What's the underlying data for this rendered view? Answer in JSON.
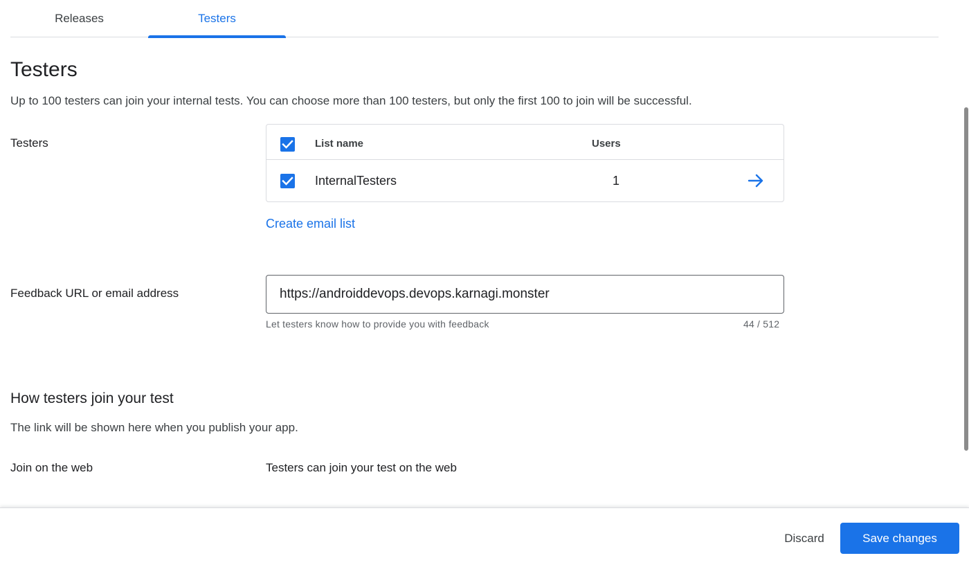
{
  "tabs": [
    {
      "label": "Releases",
      "active": false
    },
    {
      "label": "Testers",
      "active": true
    }
  ],
  "page": {
    "title": "Testers",
    "description": "Up to 100 testers can join your internal tests. You can choose more than 100 testers, but only the first 100 to join will be successful."
  },
  "testers": {
    "label": "Testers",
    "table": {
      "header": {
        "list_name": "List name",
        "users": "Users",
        "select_all_checked": true
      },
      "rows": [
        {
          "name": "InternalTesters",
          "users": "1",
          "checked": true,
          "action_icon": "arrow-right-icon"
        }
      ]
    },
    "create_link": "Create email list"
  },
  "feedback": {
    "label": "Feedback URL or email address",
    "value": "https://androiddevops.devops.karnagi.monster",
    "helper": "Let testers know how to provide you with feedback",
    "counter": "44 / 512"
  },
  "join": {
    "title": "How testers join your test",
    "description": "The link will be shown here when you publish your app.",
    "web_label": "Join on the web",
    "web_value": "Testers can join your test on the web"
  },
  "footer": {
    "discard_label": "Discard",
    "save_label": "Save changes"
  },
  "colors": {
    "accent": "#1a73e8",
    "text_primary": "#202124",
    "text_secondary": "#5f6368",
    "divider": "#dadce0"
  }
}
